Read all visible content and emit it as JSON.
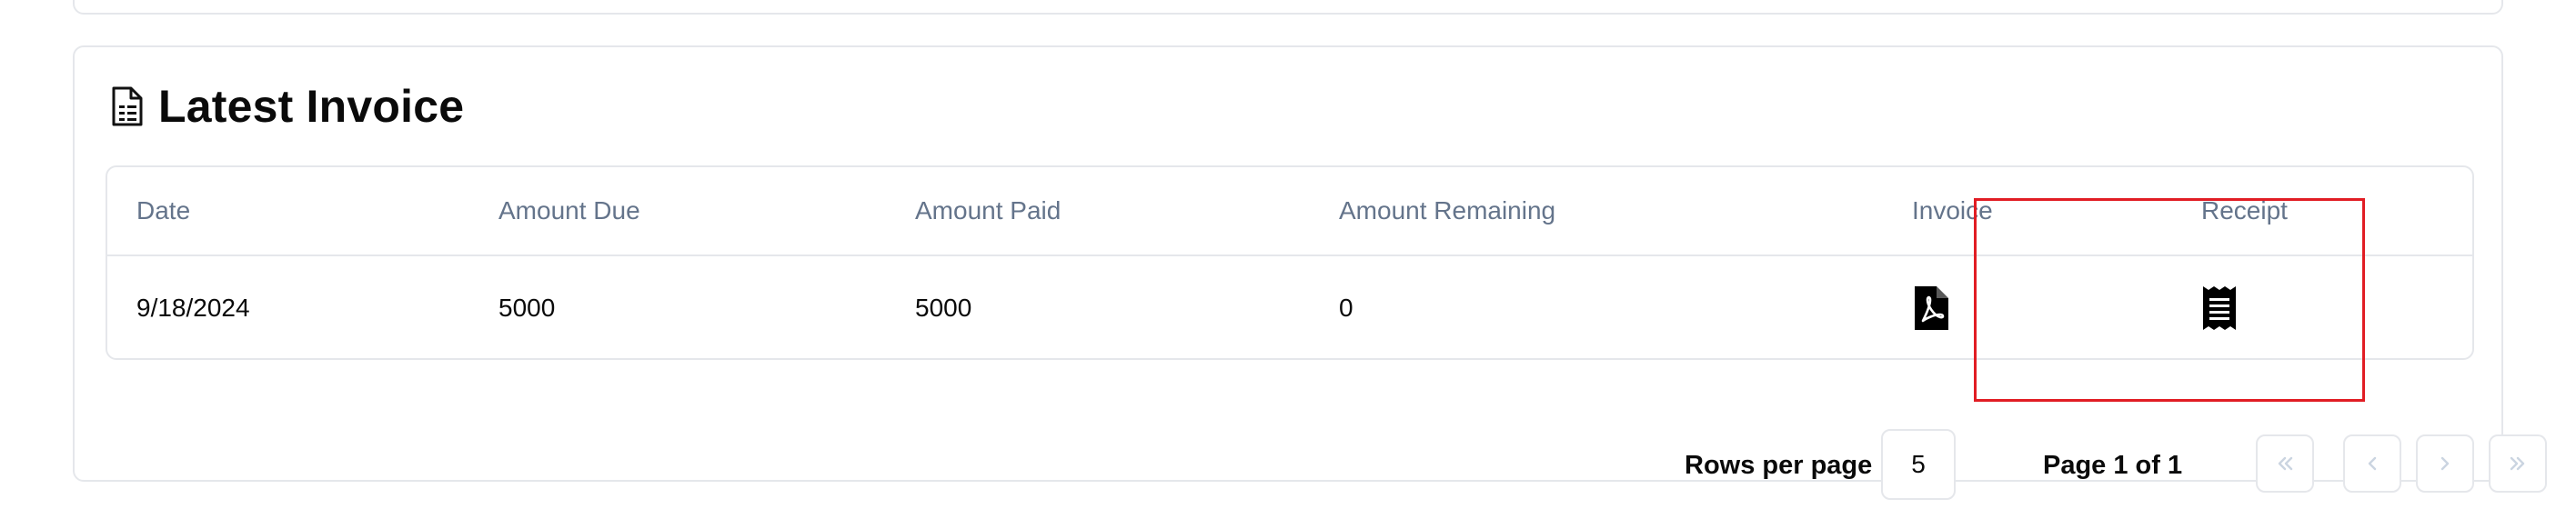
{
  "card": {
    "title": "Latest Invoice",
    "icon": "document-icon"
  },
  "table": {
    "columns": [
      "Date",
      "Amount Due",
      "Amount Paid",
      "Amount Remaining",
      "Invoice",
      "Receipt"
    ],
    "rows": [
      {
        "date": "9/18/2024",
        "amount_due": "5000",
        "amount_paid": "5000",
        "amount_remaining": "0",
        "invoice_icon": "pdf-file-icon",
        "receipt_icon": "receipt-icon"
      }
    ]
  },
  "pagination": {
    "rows_per_page_label": "Rows per page",
    "rows_per_page_value": "5",
    "page_label": "Page 1 of 1",
    "first_icon": "chevrons-left-icon",
    "prev_icon": "chevron-left-icon",
    "next_icon": "chevron-right-icon",
    "last_icon": "chevrons-right-icon"
  },
  "colors": {
    "border": "#e5e7eb",
    "header_text": "#64748b",
    "highlight": "#e11d24",
    "disabled_icon": "#cbd5e1"
  }
}
